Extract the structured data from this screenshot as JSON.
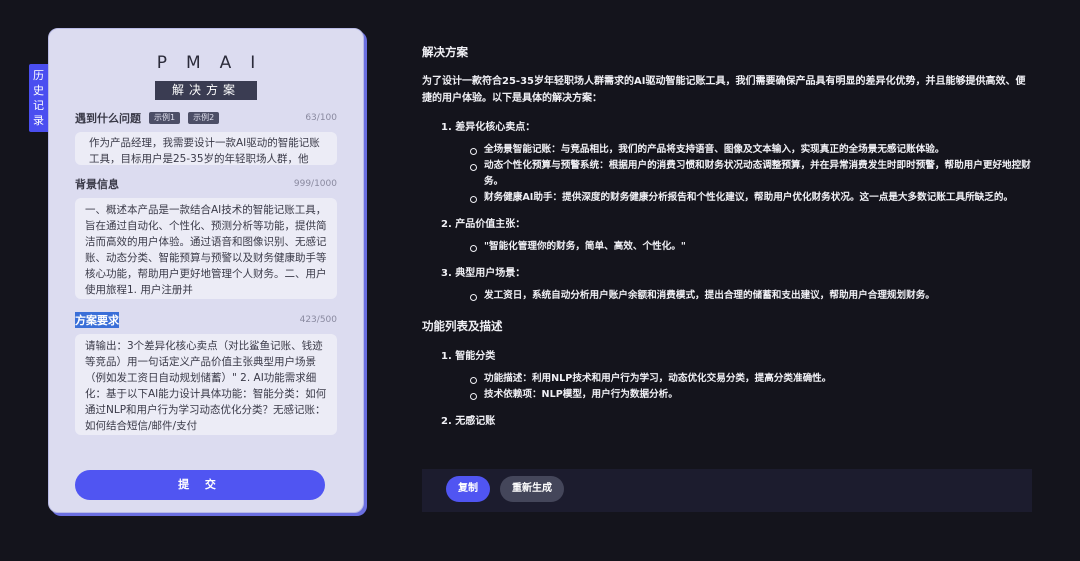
{
  "history_tab": {
    "chars": [
      "历",
      "史",
      "记",
      "录"
    ]
  },
  "app": {
    "logo": "PMAI",
    "title": "解决方案"
  },
  "problem": {
    "label": "遇到什么问题",
    "examples": [
      "示例1",
      "示例2"
    ],
    "count": "63/100",
    "text": "作为产品经理，我需要设计一款AI驱动的智能记账工具，目标用户是25-35岁的年轻职场人群，他"
  },
  "background": {
    "label": "背景信息",
    "count": "999/1000",
    "text": "一、概述本产品是一款结合AI技术的智能记账工具，旨在通过自动化、个性化、预测分析等功能，提供简洁而高效的用户体验。通过语音和图像识别、无感记账、动态分类、智能预算与预警以及财务健康助手等核心功能，帮助用户更好地管理个人财务。二、用户使用旅程1. 用户注册并"
  },
  "requirements": {
    "label": "方案要求",
    "count": "423/500",
    "text": "请输出：3个差异化核心卖点（对比鲨鱼记账、钱迹等竞品）用一句话定义产品价值主张典型用户场景（例如发工资日自动规划储蓄）\" 2. AI功能需求细化：基于以下AI能力设计具体功能：智能分类：如何通过NLP和用户行为学习动态优化分类？无感记账：如何结合短信/邮件/支付"
  },
  "submit_label": "提 交",
  "result": {
    "heading1": "解决方案",
    "intro": "为了设计一款符合25-35岁年轻职场人群需求的AI驱动智能记账工具，我们需要确保产品具有明显的差异化优势，并且能够提供高效、便捷的用户体验。以下是具体的解决方案：",
    "sec1_title": "1. 差异化核心卖点：",
    "sec1_items": [
      "全场景智能记账：与竞品相比，我们的产品将支持语音、图像及文本输入，实现真正的全场景无感记账体验。",
      "动态个性化预算与预警系统：根据用户的消费习惯和财务状况动态调整预算，并在异常消费发生时即时预警，帮助用户更好地控财务。",
      "财务健康AI助手：提供深度的财务健康分析报告和个性化建议，帮助用户优化财务状况。这一点是大多数记账工具所缺乏的。"
    ],
    "sec2_title": "2. 产品价值主张：",
    "sec2_items": [
      "\"智能化管理你的财务，简单、高效、个性化。\""
    ],
    "sec3_title": "3. 典型用户场景：",
    "sec3_items": [
      "发工资日，系统自动分析用户账户余额和消费模式，提出合理的储蓄和支出建议，帮助用户合理规划财务。"
    ],
    "heading2": "功能列表及描述",
    "f1_title": "1. 智能分类",
    "f1_items": [
      "功能描述：利用NLP技术和用户行为学习，动态优化交易分类，提高分类准确性。",
      "技术依赖项：NLP模型，用户行为数据分析。"
    ],
    "f2_title": "2. 无感记账"
  },
  "actions": {
    "copy": "复制",
    "regenerate": "重新生成"
  }
}
